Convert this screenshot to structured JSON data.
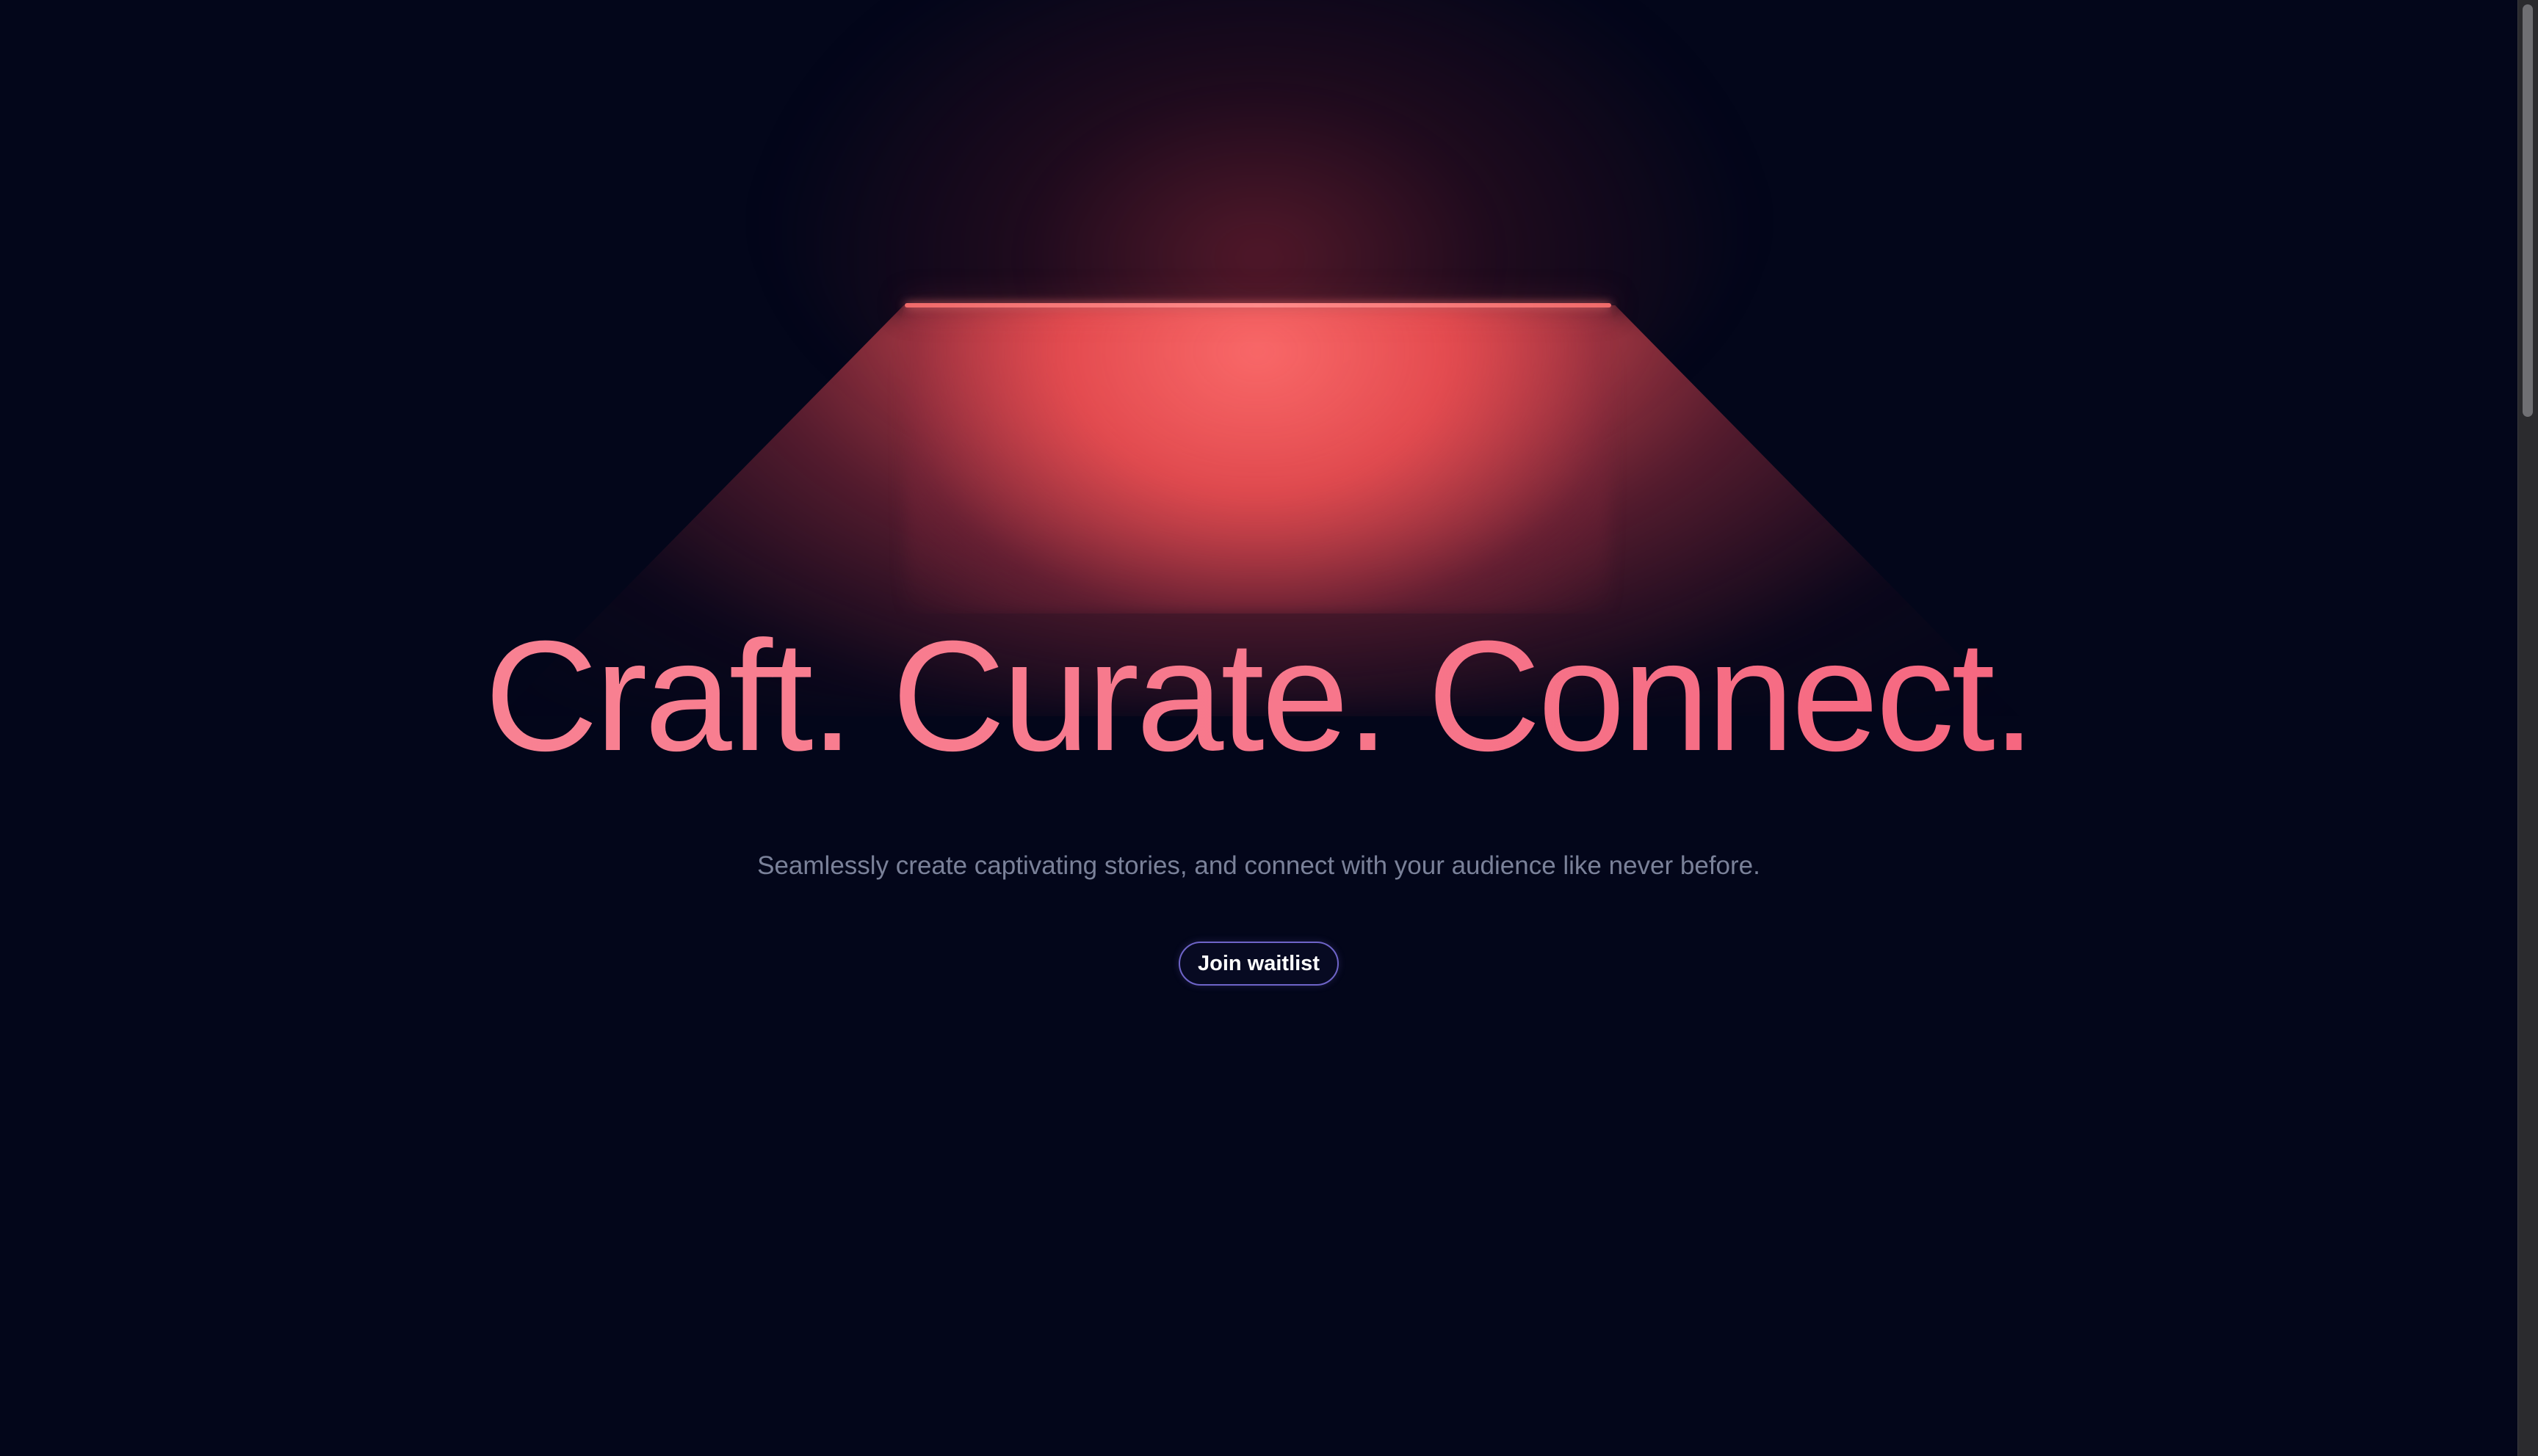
{
  "hero": {
    "headline": "Craft. Curate. Connect.",
    "subtitle": "Seamlessly create captivating stories, and connect with your audience like never before."
  },
  "cta": {
    "label": "Join waitlist"
  },
  "colors": {
    "background": "#03061a",
    "lamp": "#f06a6a",
    "headline_start": "#f98796",
    "headline_end": "#f55c78",
    "subtitle": "#7a8199",
    "button_border": "#6e64c8",
    "button_text": "#ffffff"
  }
}
